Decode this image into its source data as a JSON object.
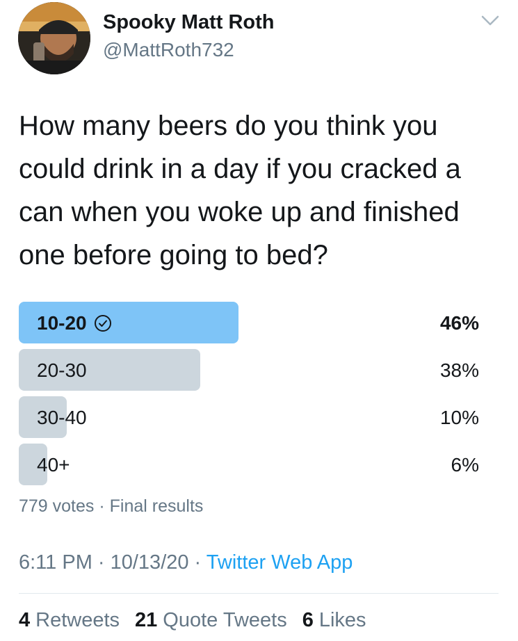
{
  "header": {
    "name": "Spooky Matt Roth",
    "handle": "@MattRoth732",
    "avatar_icon": "user-avatar-photo",
    "menu_icon": "chevron-down-icon"
  },
  "tweet": {
    "text": "How many beers do you think you could drink in a day if you cracked a can when you woke up and finished one before going to bed?"
  },
  "poll": {
    "options": [
      {
        "label": "10-20",
        "percent_text": "46%",
        "percent": 46,
        "winner": true
      },
      {
        "label": "20-30",
        "percent_text": "38%",
        "percent": 38,
        "winner": false
      },
      {
        "label": "30-40",
        "percent_text": "10%",
        "percent": 10,
        "winner": false
      },
      {
        "label": "40+",
        "percent_text": "6%",
        "percent": 6,
        "winner": false
      }
    ],
    "summary": "779 votes · Final results",
    "winner_color": "#7ec4f7",
    "other_color": "#ccd6dd"
  },
  "timestamp": {
    "time": "6:11 PM · 10/13/20 · ",
    "app": "Twitter Web App"
  },
  "stats": {
    "retweets_count": "4",
    "retweets_label": "Retweets",
    "quotes_count": "21",
    "quotes_label": "Quote Tweets",
    "likes_count": "6",
    "likes_label": "Likes"
  }
}
